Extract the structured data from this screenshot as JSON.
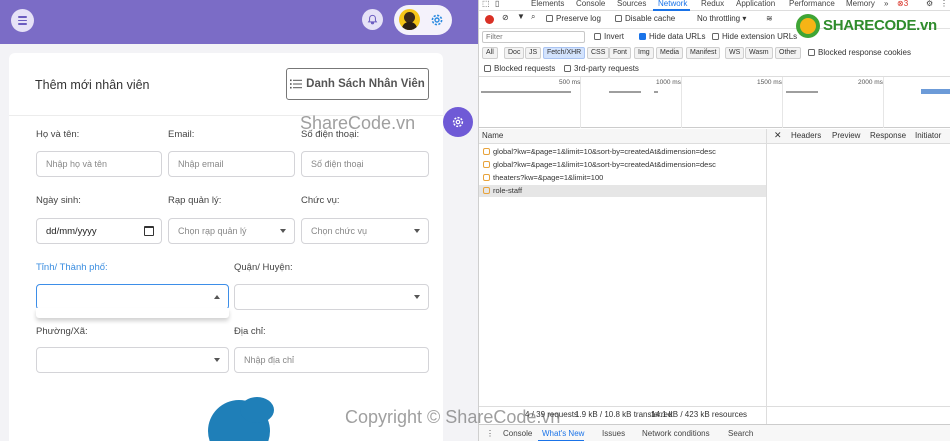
{
  "app": {
    "card": {
      "title": "Thêm mới nhân viên",
      "list_button": "Danh Sách Nhân Viên"
    },
    "form": {
      "fullname_label": "Họ và tên:",
      "fullname_placeholder": "Nhập họ và tên",
      "email_label": "Email:",
      "email_placeholder": "Nhập email",
      "phone_label": "Số điện thoại:",
      "phone_placeholder": "Số điện thoại",
      "dob_label": "Ngày sinh:",
      "dob_value": "dd/mm/yyyy",
      "theater_label": "Rạp quản lý:",
      "theater_placeholder": "Chọn rạp quản lý",
      "position_label": "Chức vụ:",
      "position_placeholder": "Chọn chức vụ",
      "province_label": "Tỉnh/ Thành phố:",
      "province_value": "",
      "district_label": "Quận/ Huyện:",
      "district_value": "",
      "ward_label": "Phường/Xã:",
      "ward_value": "",
      "address_label": "Địa chỉ:",
      "address_placeholder": "Nhập địa chỉ"
    },
    "colors": {
      "topbar": "#7b6cc6",
      "fab": "#6f5ad6",
      "focus": "#3d8ee8"
    },
    "icons": [
      "menu-icon",
      "bell-icon",
      "user-avatar",
      "gear-icon",
      "list-icon",
      "calendar-icon"
    ]
  },
  "devtools": {
    "tabs": [
      "Elements",
      "Console",
      "Sources",
      "Network",
      "Redux",
      "Application",
      "Performance",
      "Memory"
    ],
    "selected_tab": "Network",
    "error_count": "3",
    "toolbar": {
      "preserve_log": "Preserve log",
      "disable_cache": "Disable cache",
      "throttling": "No throttling"
    },
    "filter": {
      "placeholder": "Filter",
      "invert": "Invert",
      "hide_data_urls": "Hide data URLs",
      "hide_extension_urls": "Hide extension URLs"
    },
    "types": [
      "All",
      "Doc",
      "JS",
      "Fetch/XHR",
      "CSS",
      "Font",
      "Img",
      "Media",
      "Manifest",
      "WS",
      "Wasm",
      "Other"
    ],
    "selected_type": "Fetch/XHR",
    "blocked_response_cookies": "Blocked response cookies",
    "blocked_requests": "Blocked requests",
    "third_party_requests": "3rd-party requests",
    "timeline_ticks": [
      "500 ms",
      "1000 ms",
      "1500 ms",
      "2000 ms"
    ],
    "list": {
      "name_header": "Name",
      "detail_tabs": [
        "Headers",
        "Preview",
        "Response",
        "Initiator"
      ],
      "requests": [
        "global?kw=&page=1&limit=10&sort-by=createdAt&dimension=desc",
        "global?kw=&page=1&limit=10&sort-by=createdAt&dimension=desc",
        "theaters?kw=&page=1&limit=100",
        "role-staff"
      ]
    },
    "status": {
      "requests": "4 / 39 requests",
      "transferred": "1.9 kB / 10.8 kB transferred",
      "resources": "14.1 kB / 423 kB resources"
    },
    "drawer_tabs": [
      "Console",
      "What's New",
      "Issues",
      "Network conditions",
      "Search"
    ],
    "drawer_selected": "What's New"
  },
  "watermarks": {
    "logo": "SHARECODE.vn",
    "center": "ShareCode.vn",
    "bottom": "Copyright © ShareCode.vn"
  }
}
